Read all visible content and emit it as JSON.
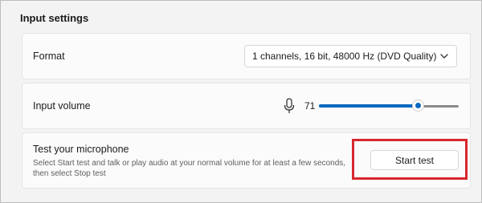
{
  "section": {
    "title": "Input settings"
  },
  "format": {
    "label": "Format",
    "selected_value": "1 channels, 16 bit, 48000 Hz (DVD Quality)",
    "chevron_icon": "chevron-down-icon"
  },
  "input_volume": {
    "label": "Input volume",
    "icon": "microphone-icon",
    "value": "71",
    "level_percent": 71,
    "accent_color": "#0067c0"
  },
  "test_microphone": {
    "title": "Test your microphone",
    "description": "Select Start test and talk or play audio at your normal volume for at least a few seconds, then select Stop test",
    "button_label": "Start test",
    "highlight_color": "#d9272e"
  }
}
